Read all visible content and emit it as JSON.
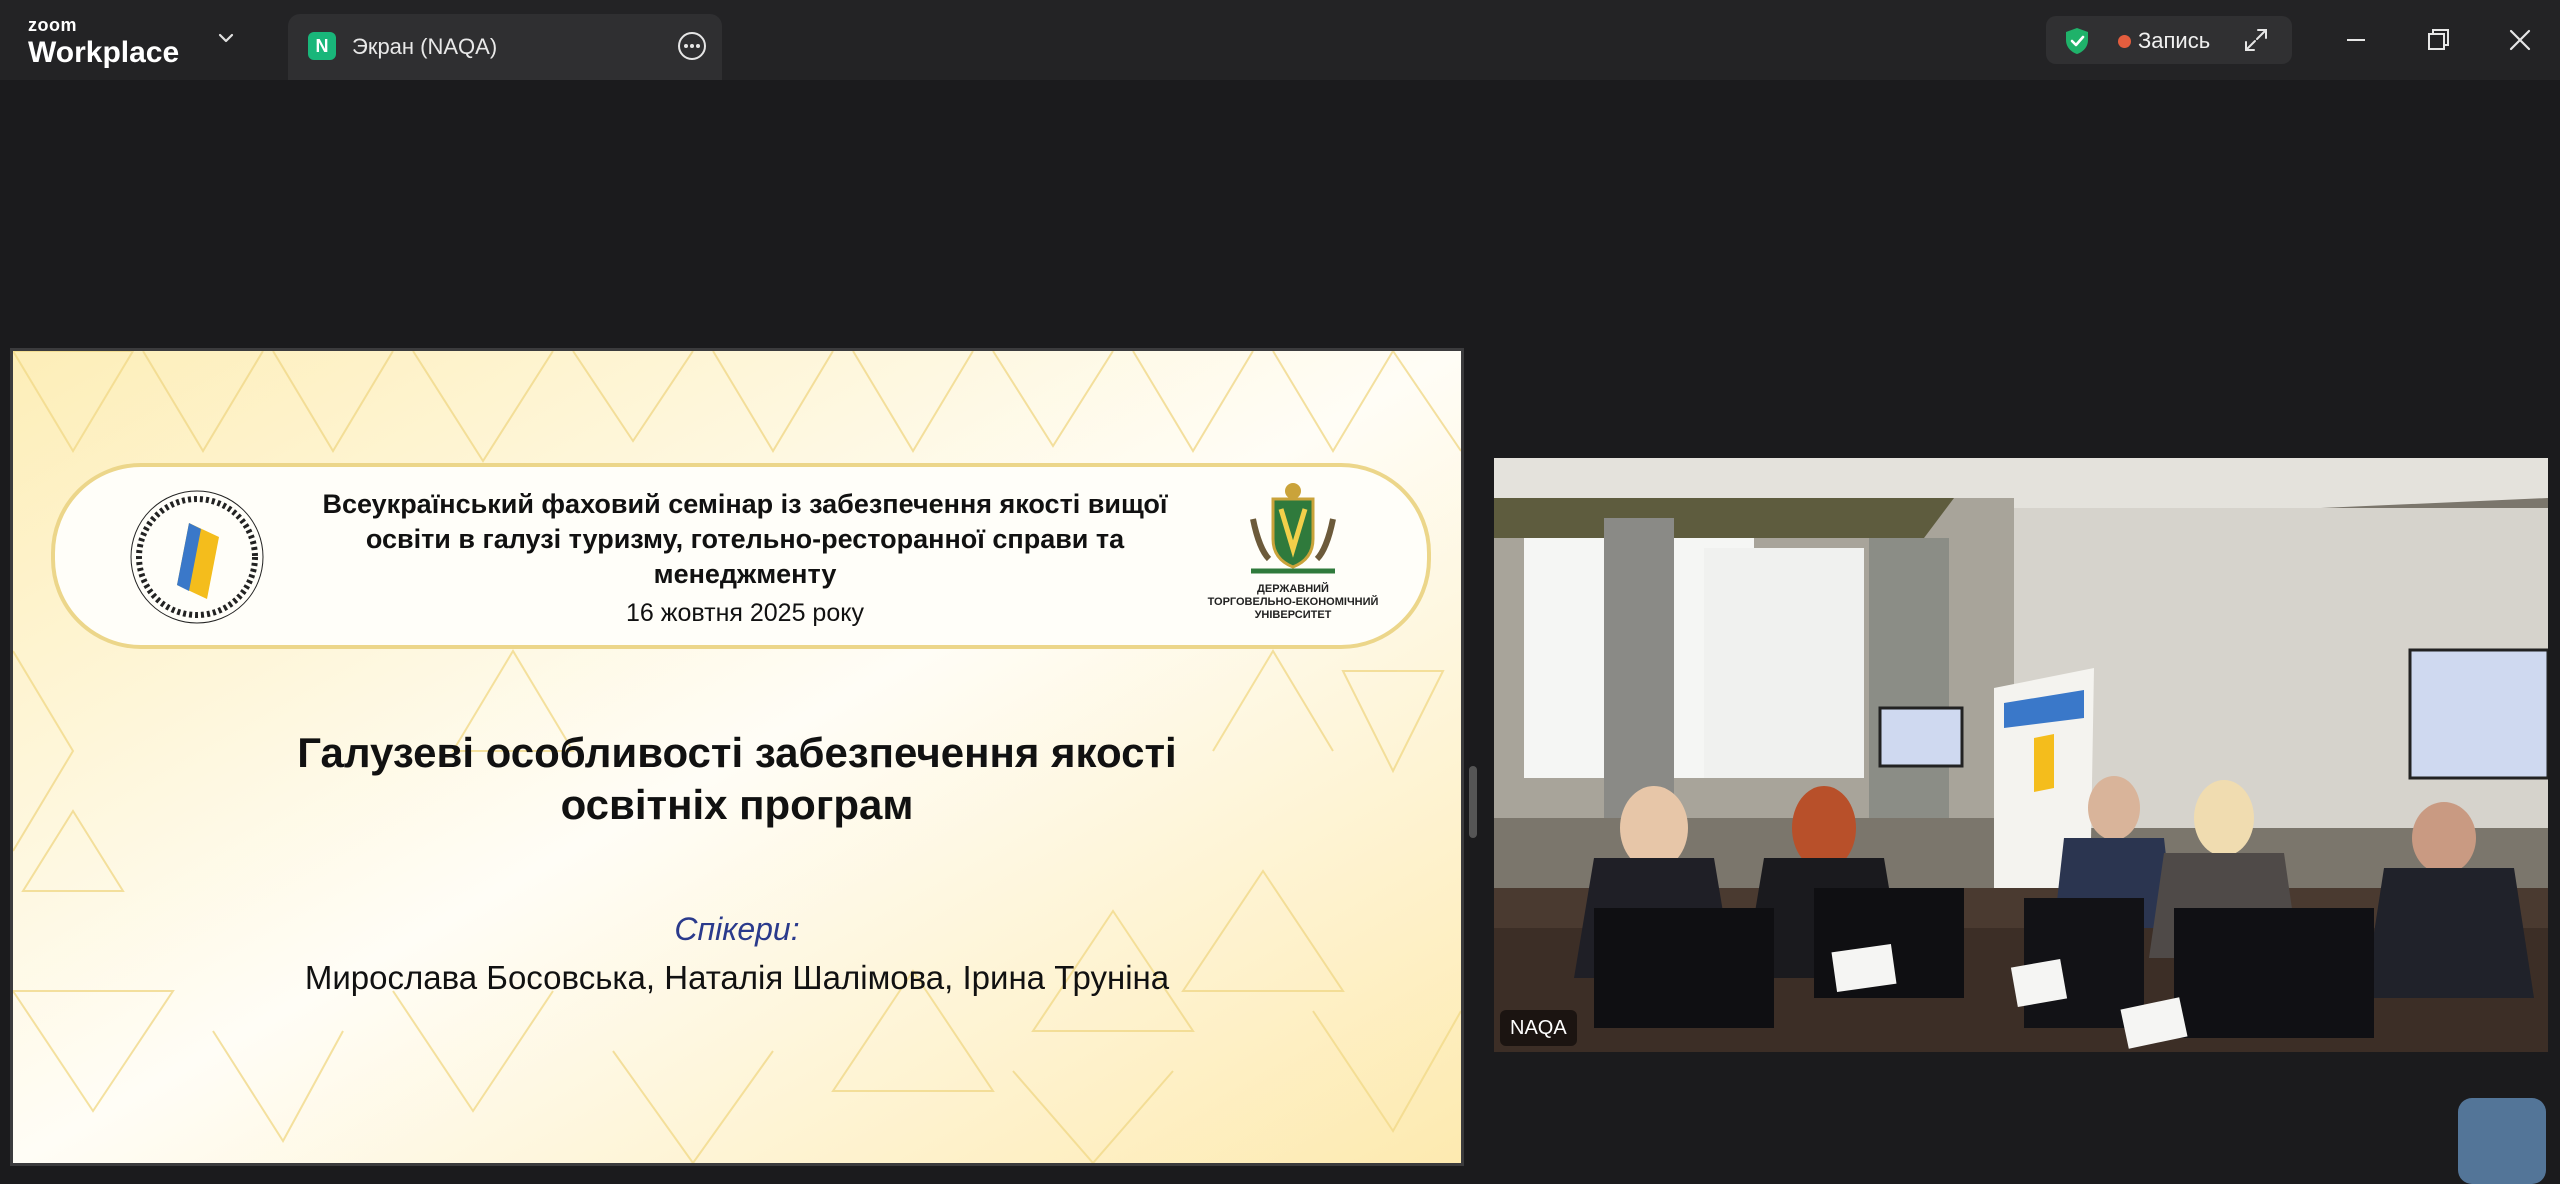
{
  "titlebar": {
    "brand_top": "zoom",
    "brand_bottom": "Workplace",
    "tab": {
      "badge": "N",
      "label": "Экран (NAQA)"
    },
    "recording": {
      "label": "Запись",
      "dot_color": "#e35d3e"
    },
    "shield_color": "#1fb26a"
  },
  "slide": {
    "banner_title": "Всеукраїнський фаховий семінар із забезпечення якості вищої освіти в галузі туризму, готельно-ресторанної справи та менеджменту",
    "banner_date": "16 жовтня 2025 року",
    "naqa_ring_text": "НАЦІОНАЛЬНЕ АГЕНТСТВО ІЗ ЗАБЕЗПЕЧЕННЯ ЯКОСТІ ВИЩОЇ ОСВІТИ",
    "university_name_line1": "ДЕРЖАВНИЙ",
    "university_name_line2": "ТОРГОВЕЛЬНО-ЕКОНОМІЧНИЙ",
    "university_name_line3": "УНІВЕРСИТЕТ",
    "heading_line1": "Галузеві особливості забезпечення якості",
    "heading_line2": "освітніх програм",
    "speakers_label": "Спікери:",
    "speakers": "Мирослава Босовська, Наталія Шалімова, Ірина Труніна"
  },
  "video": {
    "participant_name": "NAQA"
  }
}
